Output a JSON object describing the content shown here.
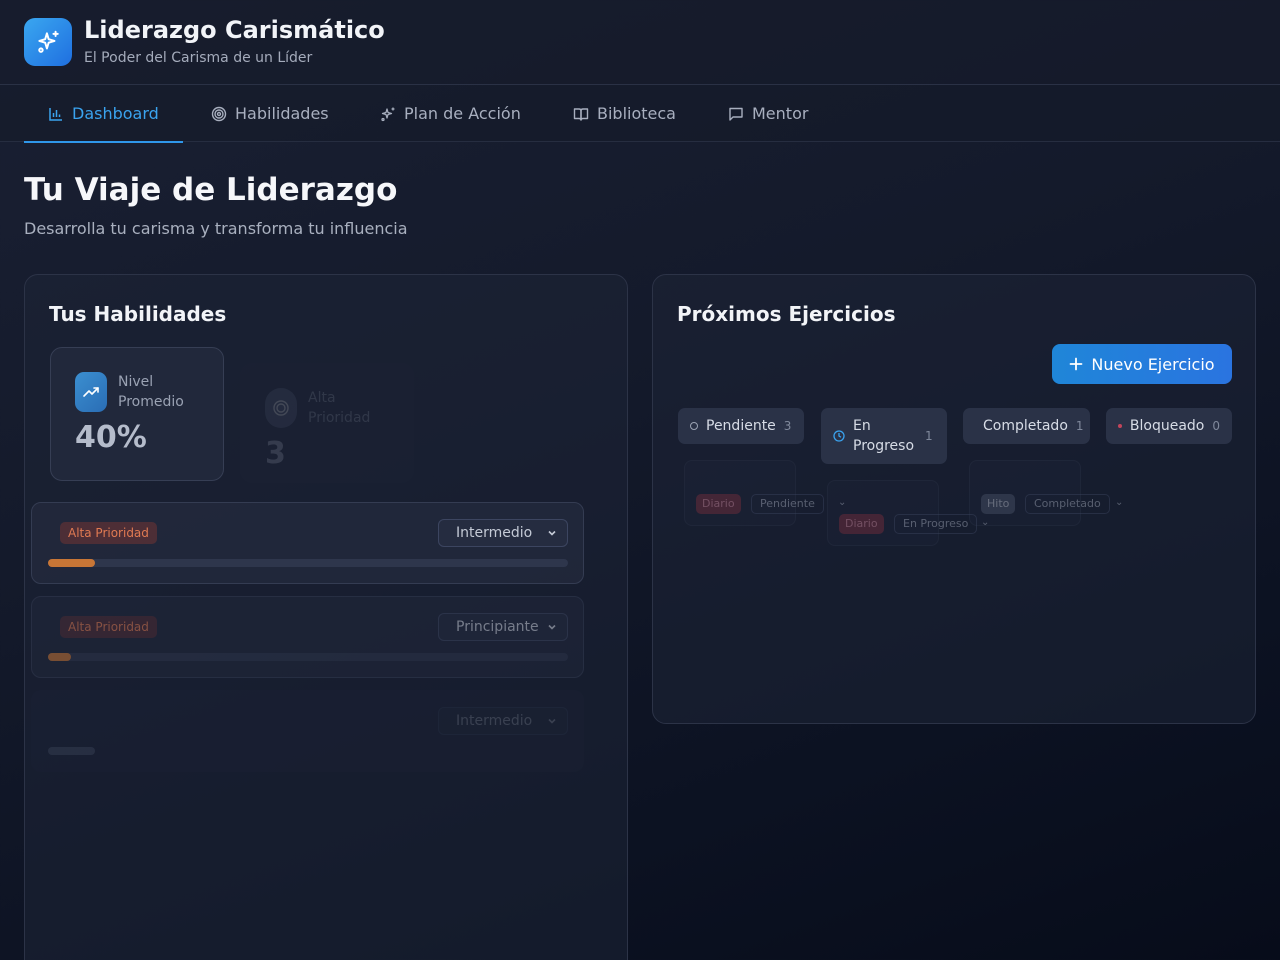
{
  "app": {
    "title": "Liderazgo Carismático",
    "subtitle": "El Poder del Carisma de un Líder"
  },
  "nav": {
    "tabs": [
      {
        "label": "Dashboard",
        "icon": "bar-chart-icon",
        "active": true
      },
      {
        "label": "Habilidades",
        "icon": "target-icon",
        "active": false
      },
      {
        "label": "Plan de Acción",
        "icon": "sparkles-icon",
        "active": false
      },
      {
        "label": "Biblioteca",
        "icon": "book-icon",
        "active": false
      },
      {
        "label": "Mentor",
        "icon": "chat-icon",
        "active": false
      }
    ]
  },
  "page": {
    "title": "Tu Viaje de Liderazgo",
    "subtitle": "Desarrolla tu carisma y transforma tu influencia"
  },
  "skills_card": {
    "title": "Tus Habilidades",
    "stats": [
      {
        "label": "Nivel Promedio",
        "value": "40%",
        "icon": "trending-up-icon"
      },
      {
        "label": "Alta Prioridad",
        "value": "3",
        "icon": "target-icon"
      }
    ],
    "skills": [
      {
        "priority": "Alta Prioridad",
        "level": "Intermedio",
        "progress": 0.09
      },
      {
        "priority": "Alta Prioridad",
        "level": "Principiante",
        "progress": 0.045
      },
      {
        "priority": "",
        "level": "Intermedio",
        "progress": 0.09
      }
    ]
  },
  "exercises_card": {
    "title": "Próximos Ejercicios",
    "new_button": "Nuevo Ejercicio",
    "statuses": [
      {
        "label": "Pendiente",
        "count": "3"
      },
      {
        "label": "En Progreso",
        "count": "1"
      },
      {
        "label": "Completado",
        "count": "1"
      },
      {
        "label": "Bloqueado",
        "count": "0"
      }
    ],
    "exercises": [
      {
        "tag": "Diario",
        "status": "Pendiente"
      },
      {
        "tag": "Diario",
        "status": "En Progreso"
      },
      {
        "tag": "Hito",
        "status": "Completado"
      }
    ]
  },
  "colors": {
    "accent": "#2f97ea",
    "priority": "#e07a52",
    "progress": "#c87636"
  }
}
